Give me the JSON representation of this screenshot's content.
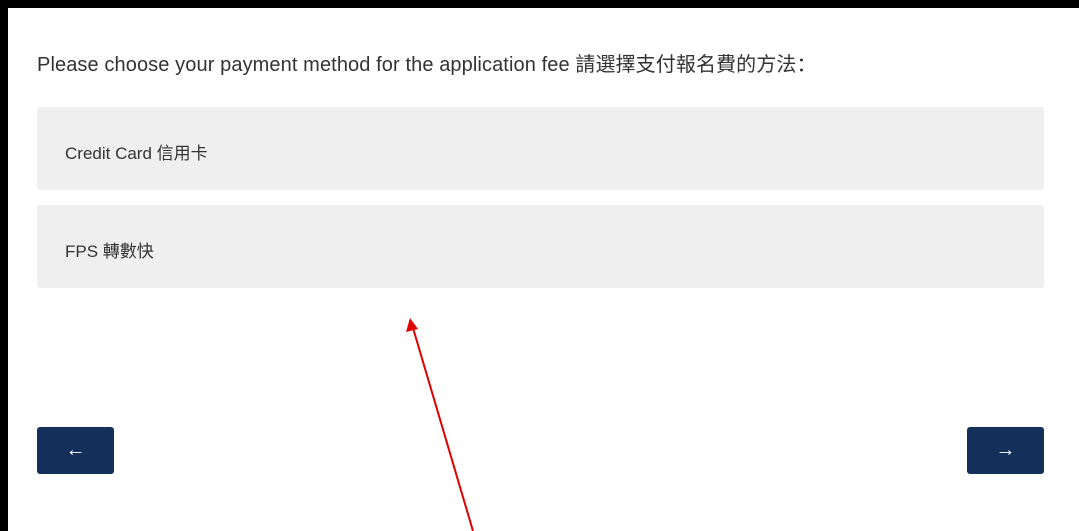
{
  "form": {
    "prompt": "Please choose your payment method for the application fee 請選擇支付報名費的方法：",
    "options": [
      {
        "label": "Credit Card 信用卡"
      },
      {
        "label": "FPS 轉數快"
      }
    ],
    "back_icon": "left-arrow",
    "back_glyph": "←",
    "next_icon": "right-arrow",
    "next_glyph": "→"
  },
  "colors": {
    "option_background": "#efefef",
    "nav_button": "#12305a",
    "annotation_arrow": "#e00000",
    "frame_border": "#000000"
  }
}
